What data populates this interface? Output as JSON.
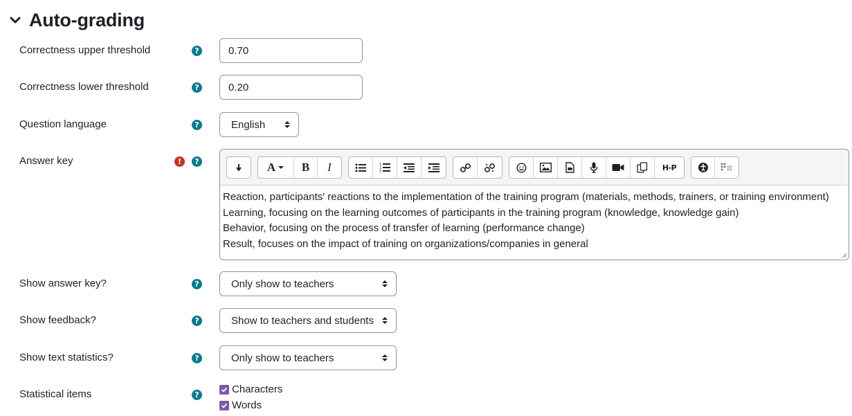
{
  "section": {
    "title": "Auto-grading",
    "toggle_icon": "chevron-down-icon"
  },
  "fields": {
    "upper_threshold": {
      "label": "Correctness upper threshold",
      "value": "0.70"
    },
    "lower_threshold": {
      "label": "Correctness lower threshold",
      "value": "0.20"
    },
    "question_language": {
      "label": "Question language",
      "value": "English"
    },
    "answer_key": {
      "label": "Answer key",
      "lines": [
        "Reaction, participants' reactions to the implementation of the training program (materials, methods, trainers, or training environment)",
        "Learning, focusing on the learning outcomes of participants in the training program (knowledge, knowledge gain)",
        "Behavior, focusing on the process of transfer of learning (performance change)",
        "Result, focuses on the impact of training on organizations/companies in general"
      ]
    },
    "show_answer_key": {
      "label": "Show answer key?",
      "value": "Only show to teachers"
    },
    "show_feedback": {
      "label": "Show feedback?",
      "value": "Show to teachers and students"
    },
    "show_text_statistics": {
      "label": "Show text statistics?",
      "value": "Only show to teachers"
    },
    "statistical_items": {
      "label": "Statistical items",
      "options": [
        {
          "label": "Characters",
          "checked": true
        },
        {
          "label": "Words",
          "checked": true
        }
      ]
    }
  },
  "toolbar": {
    "icons": [
      "collapse-icon",
      "font-color-icon",
      "bold-icon",
      "italic-icon",
      "unordered-list-icon",
      "ordered-list-icon",
      "outdent-icon",
      "indent-icon",
      "link-icon",
      "unlink-icon",
      "emoji-icon",
      "image-icon",
      "media-icon",
      "audio-record-icon",
      "video-record-icon",
      "manage-files-icon",
      "h5p-icon",
      "accessibility-checker-icon",
      "screenreader-helper-icon"
    ],
    "bold_label": "B",
    "italic_label": "I",
    "font_label": "A",
    "h5p_label": "H-P"
  },
  "colors": {
    "help": "#0a7a8f",
    "required": "#ca3120",
    "checkbox": "#7c5aa6"
  }
}
